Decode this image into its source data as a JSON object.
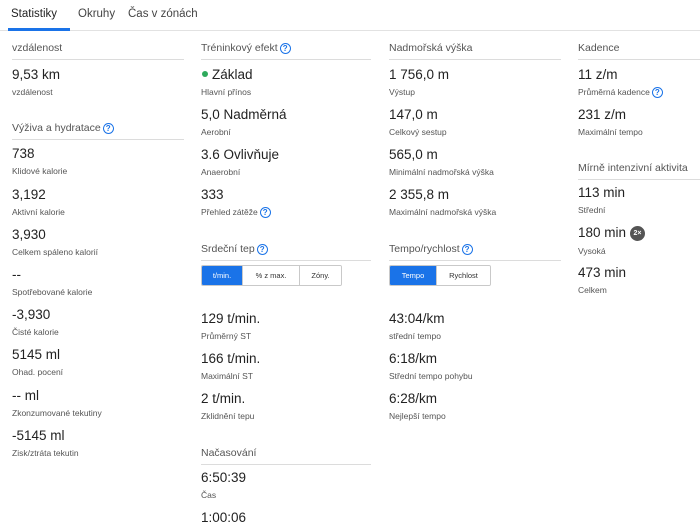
{
  "tabs": [
    {
      "label": "Statistiky"
    },
    {
      "label": "Okruhy"
    },
    {
      "label": "Čas v zónách"
    }
  ],
  "col1": {
    "distance": {
      "header": "vzdálenost",
      "value": "9,53 km",
      "label": "vzdálenost"
    },
    "nutrition": {
      "header": "Výživa a hydratace",
      "rows": [
        {
          "value": "738",
          "label": "Klidové kalorie"
        },
        {
          "value": "3,192",
          "label": "Aktivní kalorie"
        },
        {
          "value": "3,930",
          "label": "Celkem spáleno kalorií"
        },
        {
          "value": "--",
          "label": "Spotřebované kalorie"
        },
        {
          "value": "-3,930",
          "label": "Čisté kalorie"
        },
        {
          "value": "5145 ml",
          "label": "Ohad. pocení"
        },
        {
          "value": "-- ml",
          "label": "Zkonzumované tekutiny"
        },
        {
          "value": "-5145 ml",
          "label": "Zisk/ztráta tekutin"
        }
      ]
    }
  },
  "col2": {
    "training": {
      "header": "Tréninkový efekt",
      "rows": [
        {
          "value": "Základ",
          "label": "Hlavní přínos"
        },
        {
          "value": "5,0 Nadměrná",
          "label": "Aerobní"
        },
        {
          "value": "3.6 Ovlivňuje",
          "label": "Anaerobní"
        },
        {
          "value": "333",
          "label": "Přehled zátěže"
        }
      ]
    },
    "heart": {
      "header": "Srdeční tep",
      "toggle": [
        "t/min.",
        "% z max.",
        "Zóny."
      ],
      "rows": [
        {
          "value": "129 t/min.",
          "label": "Průměrný ST"
        },
        {
          "value": "166 t/min.",
          "label": "Maximální ST"
        },
        {
          "value": "2 t/min.",
          "label": "Zklidnění tepu"
        }
      ]
    },
    "timing": {
      "header": "Načasování",
      "rows": [
        {
          "value": "6:50:39",
          "label": "Čas"
        },
        {
          "value": "1:00:06",
          "label": ""
        }
      ]
    }
  },
  "col3": {
    "elevation": {
      "header": "Nadmořská výška",
      "rows": [
        {
          "value": "1 756,0 m",
          "label": "Výstup"
        },
        {
          "value": "147,0 m",
          "label": "Celkový sestup"
        },
        {
          "value": "565,0 m",
          "label": "Minimální nadmořská výška"
        },
        {
          "value": "2 355,8 m",
          "label": "Maximální nadmořská výška"
        }
      ]
    },
    "pace": {
      "header": "Tempo/rychlost",
      "toggle": [
        "Tempo",
        "Rychlost"
      ],
      "rows": [
        {
          "value": "43:04/km",
          "label": "střední tempo"
        },
        {
          "value": "6:18/km",
          "label": "Střední tempo pohybu"
        },
        {
          "value": "6:28/km",
          "label": "Nejlepší tempo"
        }
      ]
    }
  },
  "col4": {
    "cadence": {
      "header": "Kadence",
      "rows": [
        {
          "value": "11 z/m",
          "label": "Průměrná kadence"
        },
        {
          "value": "231 z/m",
          "label": "Maximální tempo"
        }
      ]
    },
    "intensity": {
      "header": "Mírně intenzivní aktivita",
      "rows": [
        {
          "value": "113 min",
          "label": "Střední"
        },
        {
          "value": "180 min",
          "label": "Vysoká",
          "badge": "2×"
        },
        {
          "value": "473 min",
          "label": "Celkem"
        }
      ]
    }
  },
  "icons": {
    "help": "question-circle-icon",
    "dot": "status-dot-icon",
    "badge": "multiplier-badge-icon"
  },
  "colors": {
    "accent": "#1a73e8",
    "dot": "#2eaa5c",
    "badge": "#555555"
  }
}
